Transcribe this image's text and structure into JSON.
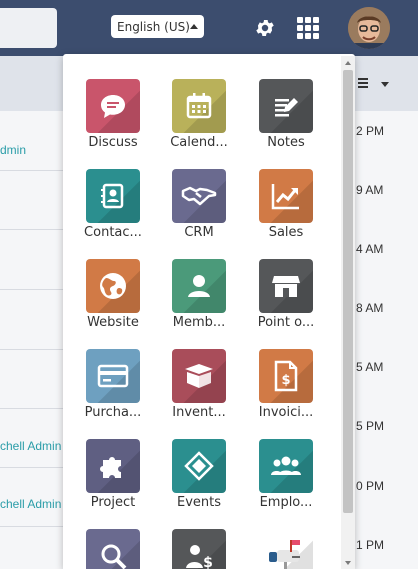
{
  "topbar": {
    "language": "English (US)",
    "icons": {
      "settings": "gear-icon",
      "apps": "apps-grid-icon"
    }
  },
  "background": {
    "left_links": [
      "dmin",
      "chell Admin",
      "chell Admin"
    ],
    "right_times": [
      "2 PM",
      "9 AM",
      "4 AM",
      "8 AM",
      "5 AM",
      "5 PM",
      "0 PM",
      "1 PM"
    ]
  },
  "apps": [
    {
      "label": "Discuss",
      "icon": "chat-bubble-icon",
      "color": "#c9556b"
    },
    {
      "label": "Calend...",
      "icon": "calendar-icon",
      "color": "#b9b15a"
    },
    {
      "label": "Notes",
      "icon": "notes-icon",
      "color": "#555759"
    },
    {
      "label": "Contac...",
      "icon": "contact-book-icon",
      "color": "#2b8f8f"
    },
    {
      "label": "CRM",
      "icon": "handshake-icon",
      "color": "#6a6a8f"
    },
    {
      "label": "Sales",
      "icon": "sales-chart-icon",
      "color": "#d17a46"
    },
    {
      "label": "Website",
      "icon": "globe-icon",
      "color": "#d17a46"
    },
    {
      "label": "Memb...",
      "icon": "member-icon",
      "color": "#4b9a7a"
    },
    {
      "label": "Point o...",
      "icon": "store-icon",
      "color": "#555759"
    },
    {
      "label": "Purcha...",
      "icon": "credit-card-icon",
      "color": "#6ea0c0"
    },
    {
      "label": "Invent...",
      "icon": "box-icon",
      "color": "#a94d5a"
    },
    {
      "label": "Invoici...",
      "icon": "invoice-dollar-icon",
      "color": "#d17a46"
    },
    {
      "label": "Project",
      "icon": "puzzle-icon",
      "color": "#5f5f82"
    },
    {
      "label": "Events",
      "icon": "ticket-icon",
      "color": "#2b8f8f"
    },
    {
      "label": "Emplo...",
      "icon": "employees-icon",
      "color": "#2b8f8f"
    },
    {
      "label": "",
      "icon": "search-magnifier-icon",
      "color": "#6a6a8f"
    },
    {
      "label": "",
      "icon": "person-dollar-icon",
      "color": "#555759"
    },
    {
      "label": "",
      "icon": "mailbox-icon",
      "color": "#ffffff"
    }
  ]
}
